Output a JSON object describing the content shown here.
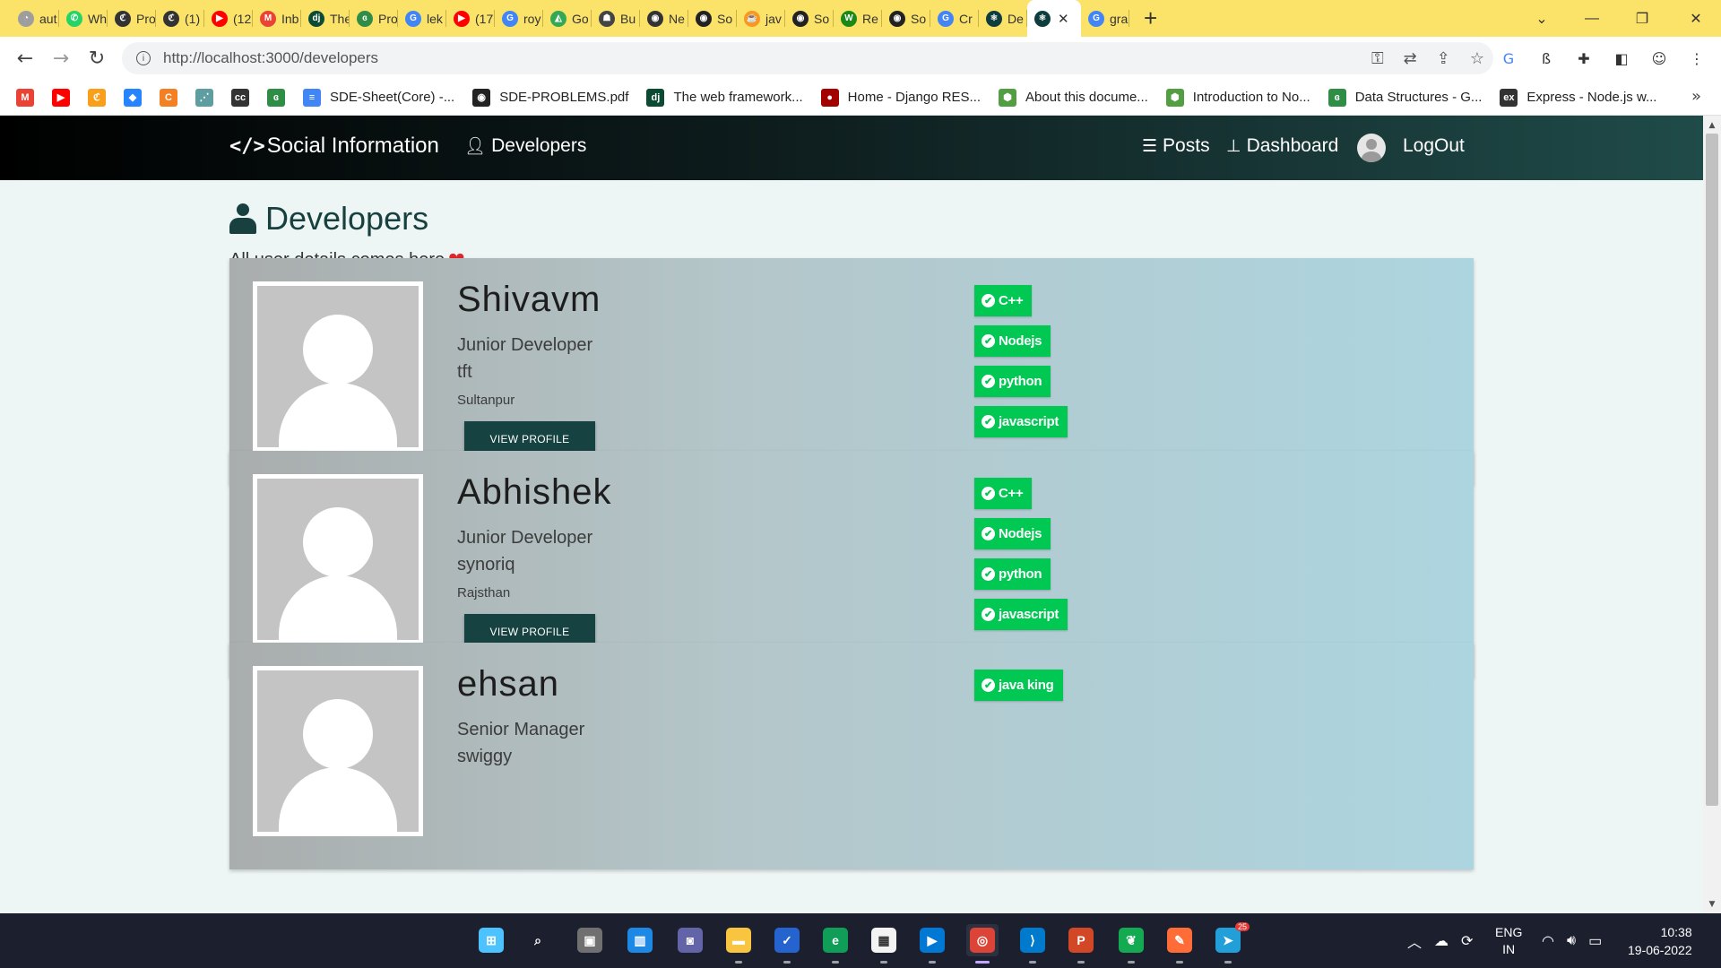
{
  "browser": {
    "tabs": [
      {
        "label": "aut",
        "color": "#9e9e9e",
        "glyph": "◔"
      },
      {
        "label": "Wh",
        "color": "#25d366",
        "glyph": "✆"
      },
      {
        "label": "Pro",
        "color": "#333333",
        "glyph": "ℭ"
      },
      {
        "label": "(1)",
        "color": "#333333",
        "glyph": "ℭ"
      },
      {
        "label": "(12",
        "color": "#ff0000",
        "glyph": "▶"
      },
      {
        "label": "Inb",
        "color": "#ea4335",
        "glyph": "M"
      },
      {
        "label": "The",
        "color": "#0c4b33",
        "glyph": "dj"
      },
      {
        "label": "Pro",
        "color": "#2f8d46",
        "glyph": "ɞ"
      },
      {
        "label": "lek",
        "color": "#4285f4",
        "glyph": "G"
      },
      {
        "label": "(17",
        "color": "#ff0000",
        "glyph": "▶"
      },
      {
        "label": "roy",
        "color": "#4285f4",
        "glyph": "G"
      },
      {
        "label": "Go",
        "color": "#34a853",
        "glyph": "◭"
      },
      {
        "label": "Bu",
        "color": "#444444",
        "glyph": "☗"
      },
      {
        "label": "Ne",
        "color": "#333333",
        "glyph": "◉"
      },
      {
        "label": "So",
        "color": "#222222",
        "glyph": "◉"
      },
      {
        "label": "jav",
        "color": "#f89820",
        "glyph": "☕"
      },
      {
        "label": "So",
        "color": "#222222",
        "glyph": "◉"
      },
      {
        "label": "Re",
        "color": "#1a8917",
        "glyph": "W"
      },
      {
        "label": "So",
        "color": "#222222",
        "glyph": "◉"
      },
      {
        "label": "Cr",
        "color": "#4285f4",
        "glyph": "G"
      },
      {
        "label": "De",
        "color": "#0d3d3d",
        "glyph": "⚛"
      },
      {
        "label": "",
        "color": "#0d3d3d",
        "glyph": "⚛",
        "active": true
      },
      {
        "label": "gra",
        "color": "#4285f4",
        "glyph": "G"
      }
    ],
    "new_tab": "+",
    "window_controls": {
      "dropdown": "⌄",
      "minimize": "—",
      "restore": "❐",
      "close": "✕"
    },
    "url": "http://localhost:3000/developers",
    "bookmarks_icons_only": [
      {
        "name": "gmail-icon",
        "color": "#ea4335",
        "glyph": "M"
      },
      {
        "name": "youtube-icon",
        "color": "#ff0000",
        "glyph": "▶"
      },
      {
        "name": "leetcode-icon",
        "color": "#f89f1b",
        "glyph": "ℭ"
      },
      {
        "name": "jira-icon",
        "color": "#2684ff",
        "glyph": "◆"
      },
      {
        "name": "codechef-icon",
        "color": "#f48024",
        "glyph": "C"
      },
      {
        "name": "graph-icon",
        "color": "#5f9ea0",
        "glyph": "⋰"
      },
      {
        "name": "cc-icon",
        "color": "#333333",
        "glyph": "cc"
      },
      {
        "name": "gfg-icon",
        "color": "#2f8d46",
        "glyph": "ɞ"
      }
    ],
    "bookmarks": [
      {
        "label": "SDE-Sheet(Core) -...",
        "color": "#4285f4",
        "glyph": "≡"
      },
      {
        "label": "SDE-PROBLEMS.pdf",
        "color": "#222222",
        "glyph": "◉"
      },
      {
        "label": "The web framework...",
        "color": "#0c4b33",
        "glyph": "dj"
      },
      {
        "label": "Home - Django RES...",
        "color": "#a30000",
        "glyph": "●"
      },
      {
        "label": "About this docume...",
        "color": "#539e43",
        "glyph": "⬢"
      },
      {
        "label": "Introduction to No...",
        "color": "#539e43",
        "glyph": "⬢"
      },
      {
        "label": "Data Structures - G...",
        "color": "#2f8d46",
        "glyph": "ɞ"
      },
      {
        "label": "Express - Node.js w...",
        "color": "#333333",
        "glyph": "ex"
      }
    ],
    "bookmarks_overflow": "»"
  },
  "site": {
    "brand": "Social Information",
    "nav": {
      "developers": "Developers",
      "posts": "Posts",
      "dashboard": "Dashboard",
      "logout": "LogOut"
    }
  },
  "page": {
    "title": "Developers",
    "subtitle": "All user details comes here",
    "heart": "❤"
  },
  "developers": [
    {
      "name": "Shivavm",
      "role": "Junior Developer",
      "company": "tft",
      "location": "Sultanpur",
      "button": "VIEW PROFILE",
      "skills": [
        "C++",
        "Nodejs",
        "python",
        "javascript"
      ]
    },
    {
      "name": "Abhishek",
      "role": "Junior Developer",
      "company": "synoriq",
      "location": "Rajsthan",
      "button": "VIEW PROFILE",
      "skills": [
        "C++",
        "Nodejs",
        "python",
        "javascript"
      ]
    },
    {
      "name": "ehsan",
      "role": "Senior Manager",
      "company": "swiggy",
      "location": "",
      "button": "",
      "skills": [
        "java king"
      ]
    }
  ],
  "taskbar": {
    "apps": [
      {
        "name": "windows-start-icon",
        "color": "#4cc2ff",
        "glyph": "⊞"
      },
      {
        "name": "search-icon",
        "color": "transparent",
        "glyph": "⌕"
      },
      {
        "name": "task-view-icon",
        "color": "#707070",
        "glyph": "▣"
      },
      {
        "name": "widgets-icon",
        "color": "#1e88e5",
        "glyph": "▥"
      },
      {
        "name": "teams-chat-icon",
        "color": "#6264a7",
        "glyph": "◙"
      },
      {
        "name": "file-explorer-icon",
        "color": "#f9c440",
        "glyph": "▬"
      },
      {
        "name": "todo-icon",
        "color": "#2564cf",
        "glyph": "✓"
      },
      {
        "name": "edge-icon",
        "color": "#0f9d58",
        "glyph": "e"
      },
      {
        "name": "store-icon",
        "color": "#f3f3f3",
        "glyph": "▦"
      },
      {
        "name": "media-player-icon",
        "color": "#0078d4",
        "glyph": "▶"
      },
      {
        "name": "chrome-icon",
        "color": "#db4437",
        "glyph": "◎",
        "active": true
      },
      {
        "name": "vscode-icon",
        "color": "#007acc",
        "glyph": "⟩"
      },
      {
        "name": "powerpoint-icon",
        "color": "#d24726",
        "glyph": "P"
      },
      {
        "name": "mongodb-compass-icon",
        "color": "#13aa52",
        "glyph": "❦"
      },
      {
        "name": "postman-icon",
        "color": "#ff6c37",
        "glyph": "✎"
      },
      {
        "name": "telegram-icon",
        "color": "#229ed9",
        "glyph": "➤"
      }
    ],
    "telegram_badge": "25",
    "language": "ENG",
    "region": "IN",
    "time": "10:38",
    "date": "19-06-2022"
  }
}
